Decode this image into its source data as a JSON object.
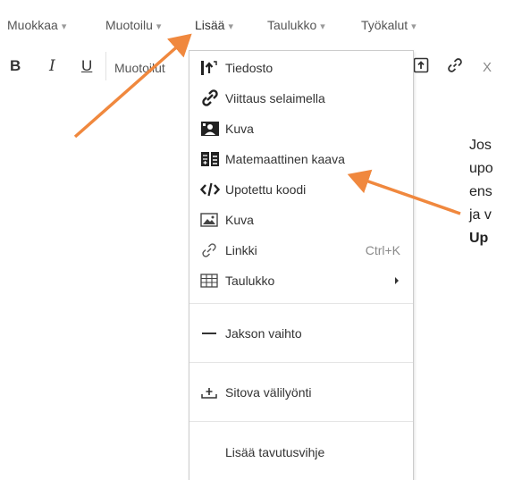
{
  "menubar": {
    "items": [
      {
        "label": "Muokkaa"
      },
      {
        "label": "Muotoilu"
      },
      {
        "label": "Lisää"
      },
      {
        "label": "Taulukko"
      },
      {
        "label": "Työkalut"
      }
    ],
    "caret": "▾"
  },
  "toolbar": {
    "bold": "B",
    "italic": "I",
    "underline": "U",
    "formats": "Muotoilut",
    "clear": "X"
  },
  "dropdown": {
    "items": [
      {
        "label": "Tiedosto",
        "icon": "file-upload-icon"
      },
      {
        "label": "Viittaus selaimella",
        "icon": "link-chain-icon"
      },
      {
        "label": "Kuva",
        "icon": "image-portrait-icon"
      },
      {
        "label": "Matemaattinen kaava",
        "icon": "formula-icon"
      },
      {
        "label": "Upotettu koodi",
        "icon": "code-icon"
      },
      {
        "label": "Kuva",
        "icon": "picture-icon"
      },
      {
        "label": "Linkki",
        "icon": "link-icon",
        "shortcut": "Ctrl+K"
      },
      {
        "label": "Taulukko",
        "icon": "table-icon",
        "submenu": true
      },
      {
        "label": "Jakson vaihto",
        "icon": "horizontal-rule-icon"
      },
      {
        "label": "Sitova välilyönti",
        "icon": "nonbreaking-space-icon"
      },
      {
        "label": "Lisää tavutusvihje",
        "icon": ""
      }
    ]
  },
  "hint": {
    "lines": [
      "Jos",
      "upo",
      "ens",
      "ja v",
      "Up"
    ]
  },
  "colors": {
    "arrow": "#F0883E",
    "text": "#333333",
    "muted": "#8a8a8a"
  }
}
